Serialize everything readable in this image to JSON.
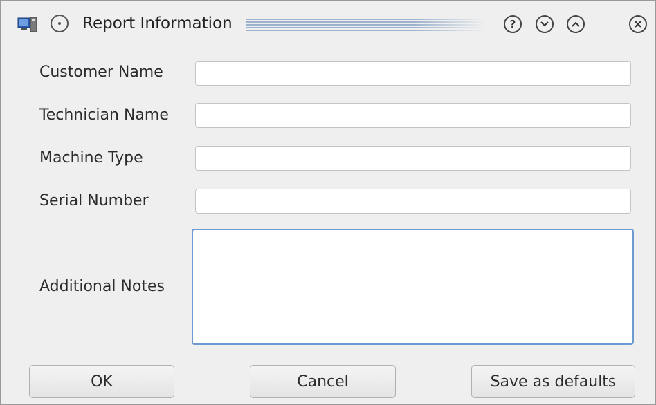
{
  "window": {
    "title": "Report Information",
    "icons": {
      "app": "computer-icon",
      "menu": "window-menu-icon",
      "help": "help-icon",
      "minimize": "minimize-icon",
      "maximize": "maximize-icon",
      "close": "close-icon"
    },
    "help_glyph": "?"
  },
  "form": {
    "customer_name": {
      "label": "Customer Name",
      "value": ""
    },
    "technician_name": {
      "label": "Technician Name",
      "value": ""
    },
    "machine_type": {
      "label": "Machine Type",
      "value": ""
    },
    "serial_number": {
      "label": "Serial Number",
      "value": ""
    },
    "additional_notes": {
      "label": "Additional Notes",
      "value": ""
    }
  },
  "buttons": {
    "ok": "OK",
    "cancel": "Cancel",
    "save_defaults": "Save as defaults"
  },
  "colors": {
    "window_bg": "#efefef",
    "focus_border": "#6c9bd2",
    "title_accent": "#8fa8c8"
  }
}
